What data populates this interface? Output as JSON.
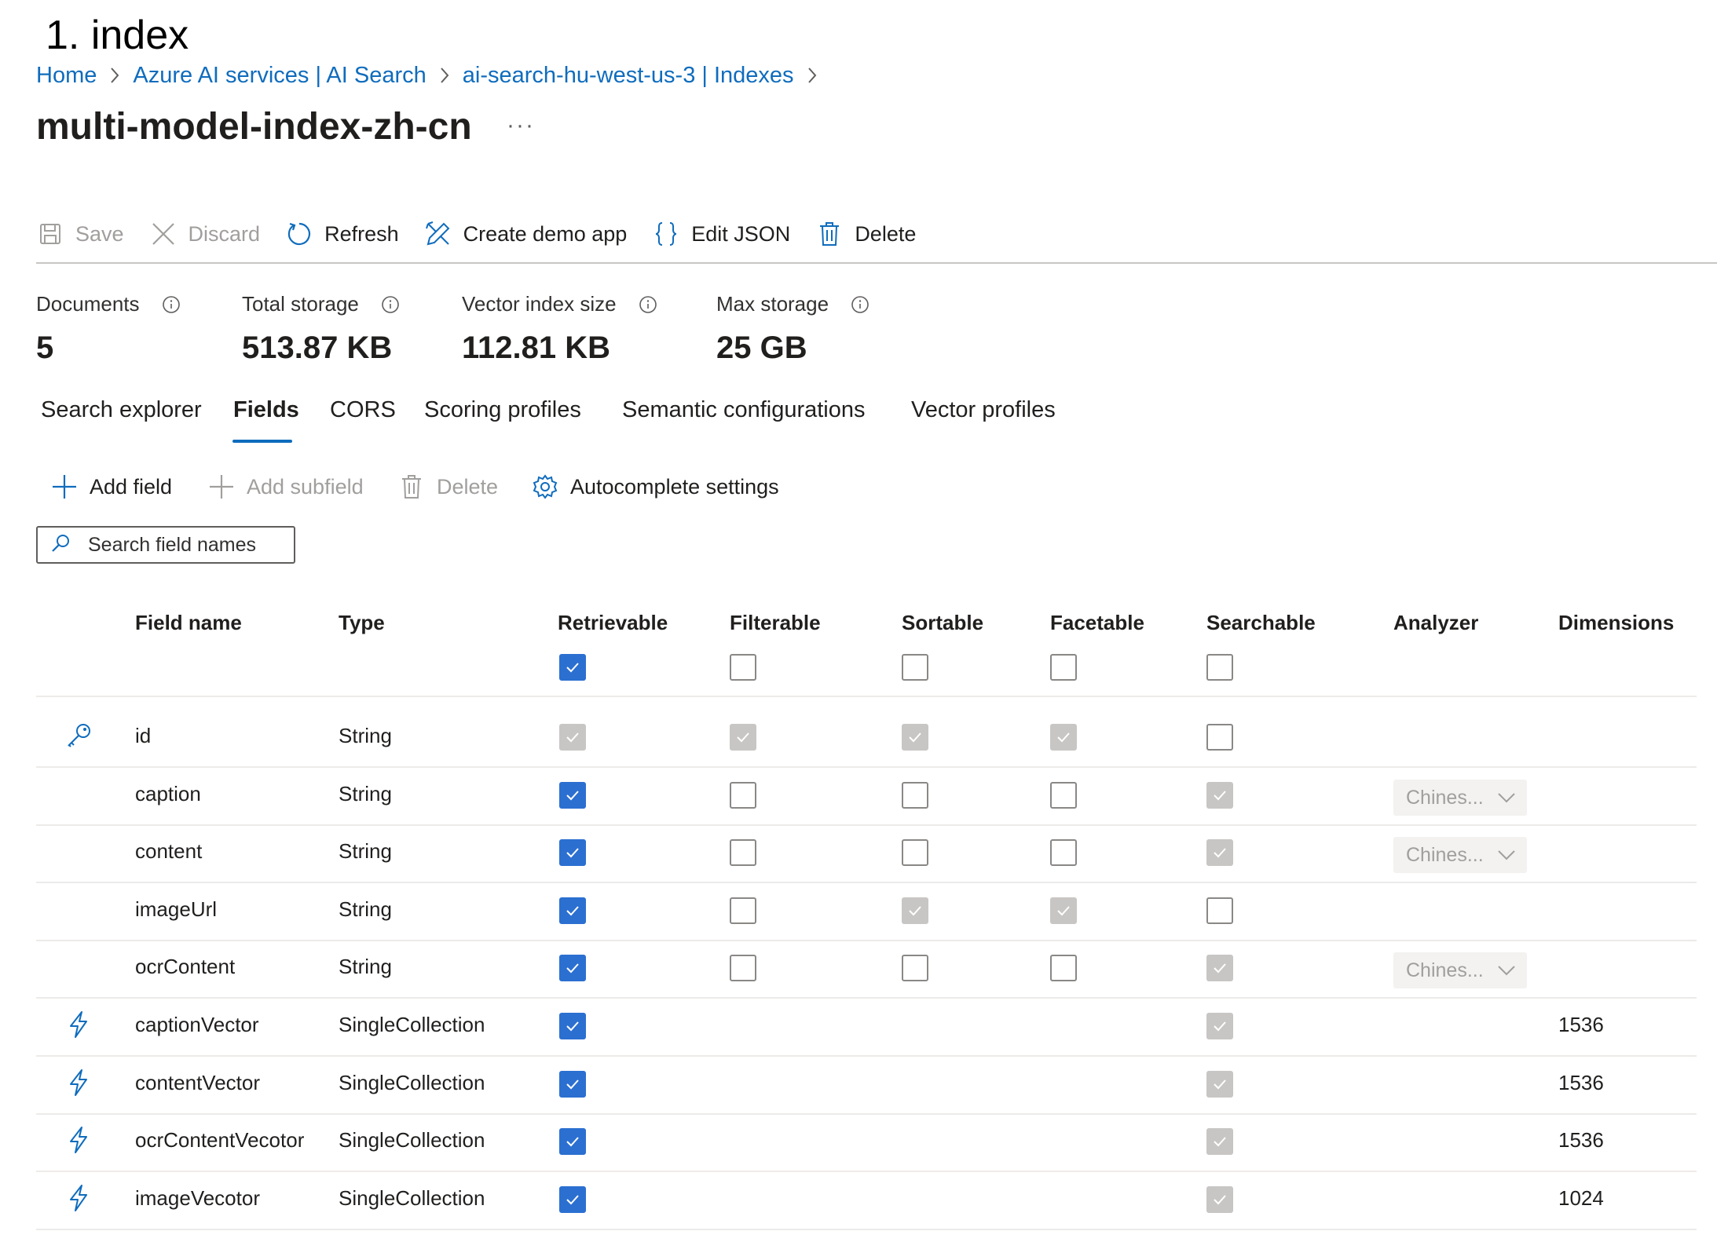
{
  "top_label": "1. index",
  "breadcrumb": [
    {
      "label": "Home"
    },
    {
      "label": "Azure AI services | AI Search"
    },
    {
      "label": "ai-search-hu-west-us-3 | Indexes"
    }
  ],
  "title": "multi-model-index-zh-cn",
  "more_label": "···",
  "toolbar": {
    "save": "Save",
    "discard": "Discard",
    "refresh": "Refresh",
    "create_demo_app": "Create demo app",
    "edit_json": "Edit JSON",
    "delete": "Delete"
  },
  "stats": [
    {
      "label": "Documents",
      "value": "5"
    },
    {
      "label": "Total storage",
      "value": "513.87 KB"
    },
    {
      "label": "Vector index size",
      "value": "112.81 KB"
    },
    {
      "label": "Max storage",
      "value": "25 GB"
    }
  ],
  "tabs": [
    {
      "label": "Search explorer",
      "active": false
    },
    {
      "label": "Fields",
      "active": true
    },
    {
      "label": "CORS",
      "active": false
    },
    {
      "label": "Scoring profiles",
      "active": false
    },
    {
      "label": "Semantic configurations",
      "active": false
    },
    {
      "label": "Vector profiles",
      "active": false
    }
  ],
  "fields_toolbar": {
    "add_field": "Add field",
    "add_subfield": "Add subfield",
    "delete": "Delete",
    "autocomplete_settings": "Autocomplete settings"
  },
  "search": {
    "placeholder": "Search field names"
  },
  "table": {
    "headers": {
      "field_name": "Field name",
      "type": "Type",
      "retrievable": "Retrievable",
      "filterable": "Filterable",
      "sortable": "Sortable",
      "facetable": "Facetable",
      "searchable": "Searchable",
      "analyzer": "Analyzer",
      "dimensions": "Dimensions"
    },
    "select_all": {
      "retrievable": "on",
      "filterable": "off",
      "sortable": "off",
      "facetable": "off",
      "searchable": "off"
    },
    "rows": [
      {
        "icon": "key-icon",
        "name": "id",
        "type": "String",
        "retrievable": "dim",
        "filterable": "dim",
        "sortable": "dim",
        "facetable": "dim",
        "searchable": "off",
        "analyzer": "",
        "dimensions": ""
      },
      {
        "icon": "",
        "name": "caption",
        "type": "String",
        "retrievable": "on",
        "filterable": "off",
        "sortable": "off",
        "facetable": "off",
        "searchable": "dim",
        "analyzer": "Chines...",
        "dimensions": ""
      },
      {
        "icon": "",
        "name": "content",
        "type": "String",
        "retrievable": "on",
        "filterable": "off",
        "sortable": "off",
        "facetable": "off",
        "searchable": "dim",
        "analyzer": "Chines...",
        "dimensions": ""
      },
      {
        "icon": "",
        "name": "imageUrl",
        "type": "String",
        "retrievable": "on",
        "filterable": "off",
        "sortable": "dim",
        "facetable": "dim",
        "searchable": "off",
        "analyzer": "",
        "dimensions": ""
      },
      {
        "icon": "",
        "name": "ocrContent",
        "type": "String",
        "retrievable": "on",
        "filterable": "off",
        "sortable": "off",
        "facetable": "off",
        "searchable": "dim",
        "analyzer": "Chines...",
        "dimensions": ""
      },
      {
        "icon": "lightning-icon",
        "name": "captionVector",
        "type": "SingleCollection",
        "retrievable": "on",
        "filterable": "",
        "sortable": "",
        "facetable": "",
        "searchable": "dim",
        "analyzer": "",
        "dimensions": "1536"
      },
      {
        "icon": "lightning-icon",
        "name": "contentVector",
        "type": "SingleCollection",
        "retrievable": "on",
        "filterable": "",
        "sortable": "",
        "facetable": "",
        "searchable": "dim",
        "analyzer": "",
        "dimensions": "1536"
      },
      {
        "icon": "lightning-icon",
        "name": "ocrContentVecotor",
        "type": "SingleCollection",
        "retrievable": "on",
        "filterable": "",
        "sortable": "",
        "facetable": "",
        "searchable": "dim",
        "analyzer": "",
        "dimensions": "1536"
      },
      {
        "icon": "lightning-icon",
        "name": "imageVecotor",
        "type": "SingleCollection",
        "retrievable": "on",
        "filterable": "",
        "sortable": "",
        "facetable": "",
        "searchable": "dim",
        "analyzer": "",
        "dimensions": "1024"
      }
    ]
  },
  "colors": {
    "accent": "#0f6cbd",
    "checkbox_on": "#2b6fd1",
    "checkbox_dim": "#c8c6c4"
  }
}
